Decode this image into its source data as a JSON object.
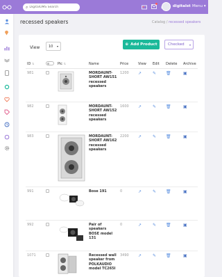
{
  "topbar": {
    "search_placeholder": "DigitalOMS Search",
    "username": "digitalst",
    "menu_label": "Menu",
    "accent": "#9b7ad8"
  },
  "page": {
    "title": "recessed speakers",
    "breadcrumb_root": "Catalog",
    "breadcrumb_sep": "/",
    "breadcrumb_current": "recessed speakers"
  },
  "toolbar": {
    "view_label": "View",
    "view_value": "10",
    "add_label": "Add Product",
    "filter_value": "Checked"
  },
  "table": {
    "headers": [
      "ID",
      "",
      "Pic",
      "Name",
      "Price",
      "View",
      "Edit",
      "Delete",
      "Archive"
    ],
    "rows": [
      {
        "id": "981",
        "name": "MORDAUNT-SHORT AW151 recessed speakers",
        "price": "1200",
        "pic": "square-speaker"
      },
      {
        "id": "982",
        "name": "MORDAUNT-SHORT AW152 recessed speakers",
        "price": "1600",
        "pic": "rect-speaker"
      },
      {
        "id": "983",
        "name": "MORDAUNT-SHORT AW162 recessed speakers",
        "price": "2200",
        "pic": "tall-speaker"
      },
      {
        "id": "991",
        "name": "Bose 191",
        "price": "0",
        "pic": "bose-pair"
      },
      {
        "id": "992",
        "name": "Pair of speakers BOSE model 131",
        "price": "0",
        "pic": "bose-131"
      },
      {
        "id": "1071",
        "name": "Recessed wall speaker from POLKAUDIO model TC265I",
        "price": "3490",
        "pic": "polk-speaker"
      }
    ]
  },
  "colors": {
    "add_button": "#1bb99a",
    "action_icon": "#5a8fe0"
  }
}
